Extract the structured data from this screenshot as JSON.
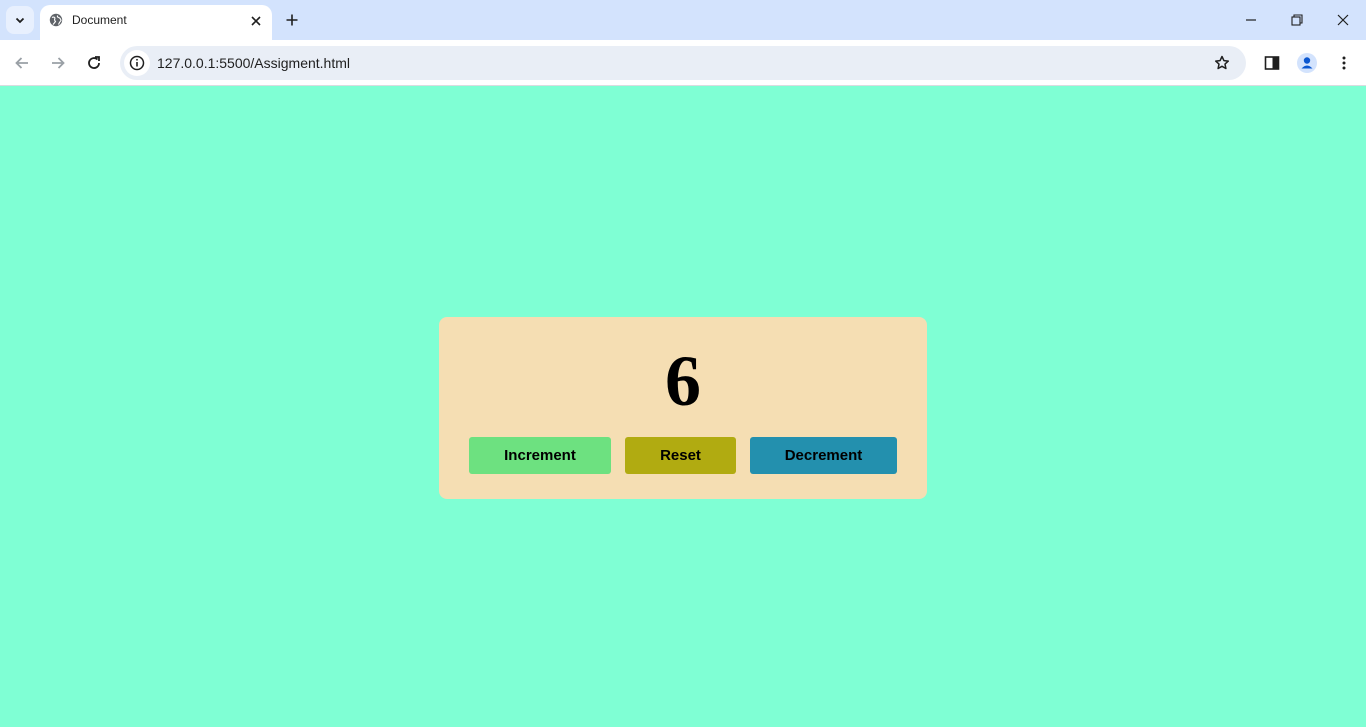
{
  "browser": {
    "tab_title": "Document",
    "url": "127.0.0.1:5500/Assigment.html"
  },
  "icons": {
    "tab_search": "chevron-down-icon",
    "favicon": "globe-icon",
    "tab_close": "close-icon",
    "new_tab": "plus-icon",
    "minimize": "minimize-icon",
    "restore": "restore-icon",
    "close_window": "close-icon",
    "back": "arrow-left-icon",
    "forward": "arrow-right-icon",
    "reload": "reload-icon",
    "site_info": "info-icon",
    "bookmark": "star-icon",
    "side_panel": "side-panel-icon",
    "profile": "profile-icon",
    "menu": "kebab-menu-icon"
  },
  "page": {
    "background": "#7fffd4",
    "card_background": "#f5deb3",
    "counter_value": "6",
    "buttons": {
      "increment": {
        "label": "Increment",
        "color": "#6de180"
      },
      "reset": {
        "label": "Reset",
        "color": "#b1ab11"
      },
      "decrement": {
        "label": "Decrement",
        "color": "#2390ae"
      }
    }
  }
}
